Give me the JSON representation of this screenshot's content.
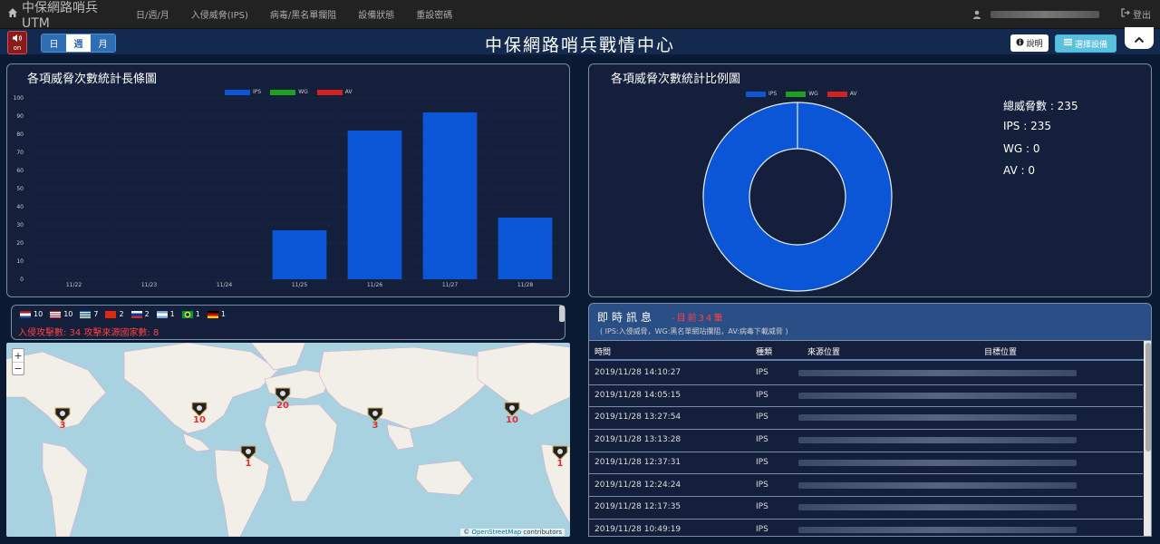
{
  "nav": {
    "brand": "中保網路哨兵UTM",
    "links": [
      "日/週/月",
      "入侵威脅(IPS)",
      "病毒/黑名單攔阻",
      "設備狀態",
      "重設密碼"
    ],
    "logout": "登出"
  },
  "titlebar": {
    "sound_label": "on",
    "segments": [
      "日",
      "週",
      "月"
    ],
    "active_segment": "週",
    "title": "中保網路哨兵戰情中心",
    "help_label": "說明",
    "select_label": "選擇設備"
  },
  "colors": {
    "ips": "#0a56d6",
    "wg": "#1ea21e",
    "av": "#d32020",
    "accent": "#5bc0de",
    "background": "#0b1a33"
  },
  "bar_panel": {
    "title": "各項威脅次數統計長條圖"
  },
  "pie_panel": {
    "title": "各項威脅次數統計比例圖",
    "total_label": "總威脅數 : 235",
    "ips_label": "IPS : 235",
    "wg_label": "WG : 0",
    "av_label": "AV : 0"
  },
  "chart_data": [
    {
      "type": "bar",
      "title": "各項威脅次數統計長條圖",
      "categories": [
        "11/22",
        "11/23",
        "11/24",
        "11/25",
        "11/26",
        "11/27",
        "11/28"
      ],
      "series": [
        {
          "name": "IPS",
          "values": [
            0,
            0,
            0,
            27,
            82,
            92,
            34
          ]
        },
        {
          "name": "WG",
          "values": [
            0,
            0,
            0,
            0,
            0,
            0,
            0
          ]
        },
        {
          "name": "AV",
          "values": [
            0,
            0,
            0,
            0,
            0,
            0,
            0
          ]
        }
      ],
      "ylim": [
        0,
        100
      ],
      "yticks": [
        0,
        10,
        20,
        30,
        40,
        50,
        60,
        70,
        80,
        90,
        100
      ],
      "legend": "top-center"
    },
    {
      "type": "pie",
      "title": "各項威脅次數統計比例圖",
      "labels": [
        "IPS",
        "WG",
        "AV"
      ],
      "values": [
        235,
        0,
        0
      ],
      "legend": "top-center"
    }
  ],
  "countries": [
    {
      "flag": "nl",
      "count": "10"
    },
    {
      "flag": "us",
      "count": "10"
    },
    {
      "flag": "gr",
      "count": "7"
    },
    {
      "flag": "cn",
      "count": "2"
    },
    {
      "flag": "ru",
      "count": "2"
    },
    {
      "flag": "ar",
      "count": "1"
    },
    {
      "flag": "br",
      "count": "1"
    },
    {
      "flag": "de",
      "count": "1"
    }
  ],
  "attack_summary": "入侵攻擊數: 34  攻擊來源國家數: 8",
  "map": {
    "zoom_in": "+",
    "zoom_out": "−",
    "attribution_link": "OpenStreetMap",
    "attribution_suffix": " contributors",
    "markers": [
      "3",
      "10",
      "20",
      "1",
      "3",
      "10",
      "1"
    ]
  },
  "realtime": {
    "title": "即時訊息",
    "count": "-目前34筆",
    "subtitle": "( IPS:入侵威脅，WG:黑名單網站攔阻，AV:病毒下載威脅 )",
    "columns": [
      "時間",
      "種類",
      "來源位置",
      "目標位置"
    ],
    "rows": [
      {
        "time": "2019/11/28 14:10:27",
        "type": "IPS"
      },
      {
        "time": "2019/11/28 14:05:15",
        "type": "IPS"
      },
      {
        "time": "2019/11/28 13:27:54",
        "type": "IPS"
      },
      {
        "time": "2019/11/28 13:13:28",
        "type": "IPS"
      },
      {
        "time": "2019/11/28 12:37:31",
        "type": "IPS"
      },
      {
        "time": "2019/11/28 12:24:24",
        "type": "IPS"
      },
      {
        "time": "2019/11/28 12:17:35",
        "type": "IPS"
      },
      {
        "time": "2019/11/28 10:49:19",
        "type": "IPS"
      }
    ]
  }
}
